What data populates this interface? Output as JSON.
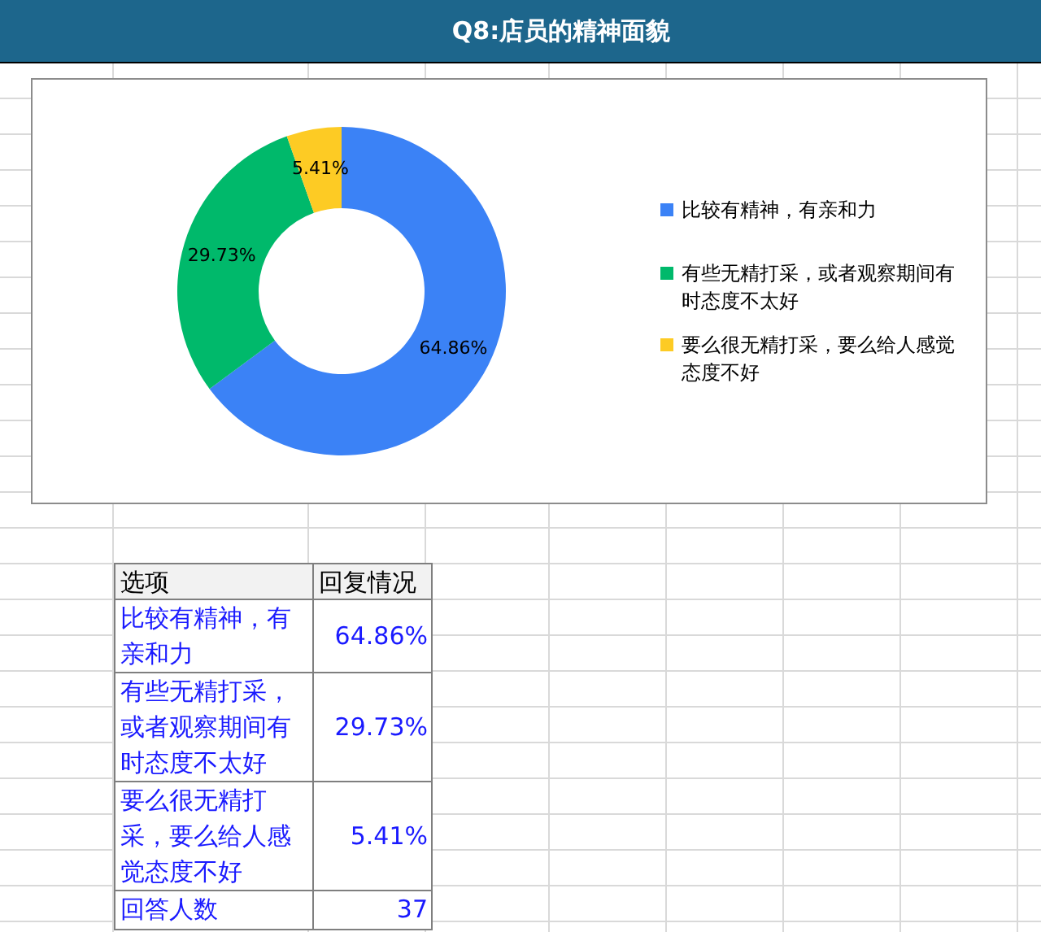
{
  "title": "Q8:店员的精神面貌",
  "chart": {
    "legend": [
      {
        "color": "#3b82f6"
      },
      {
        "color": "#00b96b"
      },
      {
        "color": "#fdcb24"
      }
    ],
    "chart_data": {
      "type": "donut",
      "categories": [
        "比较有精神，有亲和力",
        "有些无精打采，或者观察期间有时态度不太好",
        "要么很无精打采，要么给人感觉态度不好"
      ],
      "values": [
        64.86,
        29.73,
        5.41
      ],
      "value_labels": [
        "64.86%",
        "29.73%",
        "5.41%"
      ]
    }
  },
  "table": {
    "columns": [
      "选项",
      "回复情况"
    ],
    "rows": [
      {
        "option": "比较有精神，有亲和力",
        "value": "64.86%"
      },
      {
        "option": "有些无精打采，或者观察期间有时态度不太好",
        "value": "29.73%"
      },
      {
        "option": "要么很无精打采，要么给人感觉态度不好",
        "value": "5.41%"
      },
      {
        "option": "回答人数",
        "value": "37"
      }
    ]
  }
}
